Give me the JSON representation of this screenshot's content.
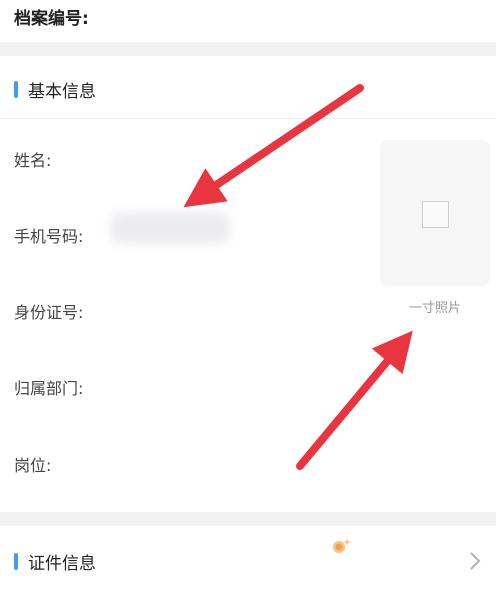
{
  "archive": {
    "label": "档案编号:"
  },
  "basic_info": {
    "title": "基本信息",
    "fields": [
      {
        "label": "姓名:"
      },
      {
        "label": "手机号码:"
      },
      {
        "label": "身份证号:"
      },
      {
        "label": "归属部门:"
      },
      {
        "label": "岗位:"
      }
    ],
    "photo_caption": "一寸照片"
  },
  "certificate_info": {
    "title": "证件信息"
  },
  "colors": {
    "accent_bar": "#3f9cf1",
    "annotation_arrow": "#e8353f",
    "band": "#f2f2f2"
  },
  "icons": [
    "image-placeholder-icon",
    "chevron-right-icon",
    "sparkle-icon",
    "annotation-arrow"
  ]
}
